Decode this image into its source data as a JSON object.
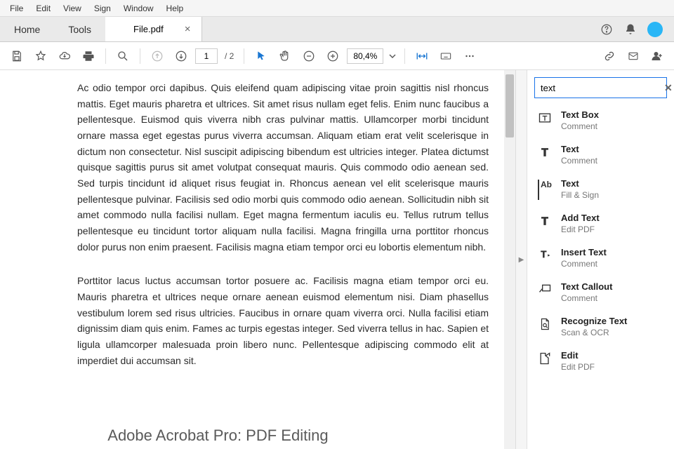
{
  "menubar": [
    "File",
    "Edit",
    "View",
    "Sign",
    "Window",
    "Help"
  ],
  "tabs": {
    "home": "Home",
    "tools": "Tools",
    "file": "File.pdf"
  },
  "toolbar": {
    "page_current": "1",
    "page_total": "/  2",
    "zoom": "80,4%"
  },
  "doc": {
    "p1": "Ac odio tempor orci dapibus. Quis eleifend quam adipiscing vitae proin sagittis nisl rhoncus mattis. Eget mauris pharetra et ultrices. Sit amet risus nullam eget felis. Enim nunc faucibus a pellentesque. Euismod quis viverra nibh cras pulvinar mattis. Ullamcorper morbi tincidunt ornare massa eget egestas purus viverra accumsan. Aliquam etiam erat velit scelerisque in dictum non consectetur. Nisl suscipit adipiscing bibendum est ultricies integer. Platea dictumst quisque sagittis purus sit amet volutpat consequat mauris. Quis commodo odio aenean sed. Sed turpis tincidunt id aliquet risus feugiat in. Rhoncus aenean vel elit scelerisque mauris pellentesque pulvinar. Facilisis sed odio morbi quis commodo odio aenean. Sollicitudin nibh sit amet commodo nulla facilisi nullam. Eget magna fermentum iaculis eu. Tellus rutrum tellus pellentesque eu tincidunt tortor aliquam nulla facilisi. Magna fringilla urna porttitor rhoncus dolor purus non enim praesent. Facilisis magna etiam tempor orci eu lobortis elementum nibh.",
    "p2": "Porttitor lacus luctus accumsan tortor posuere ac. Facilisis magna etiam tempor orci eu. Mauris pharetra et ultrices neque ornare aenean euismod elementum nisi. Diam phasellus vestibulum lorem sed risus ultricies. Faucibus in ornare quam viverra orci. Nulla facilisi etiam dignissim diam quis enim. Fames ac turpis egestas integer. Sed viverra tellus in hac. Sapien et ligula ullamcorper malesuada proin libero nunc. Pellentesque adipiscing commodo elit at imperdiet dui accumsan sit."
  },
  "search": {
    "value": "text"
  },
  "results": [
    {
      "title": "Text Box",
      "sub": "Comment",
      "icon": "textbox"
    },
    {
      "title": "Text",
      "sub": "Comment",
      "icon": "T"
    },
    {
      "title": "Text",
      "sub": "Fill & Sign",
      "icon": "Ab"
    },
    {
      "title": "Add Text",
      "sub": "Edit PDF",
      "icon": "T"
    },
    {
      "title": "Insert Text",
      "sub": "Comment",
      "icon": "Ta"
    },
    {
      "title": "Text Callout",
      "sub": "Comment",
      "icon": "callout"
    },
    {
      "title": "Recognize Text",
      "sub": "Scan & OCR",
      "icon": "doc"
    },
    {
      "title": "Edit",
      "sub": "Edit PDF",
      "icon": "edit"
    }
  ],
  "watermark": "Adobe Acrobat Pro: PDF Editing"
}
